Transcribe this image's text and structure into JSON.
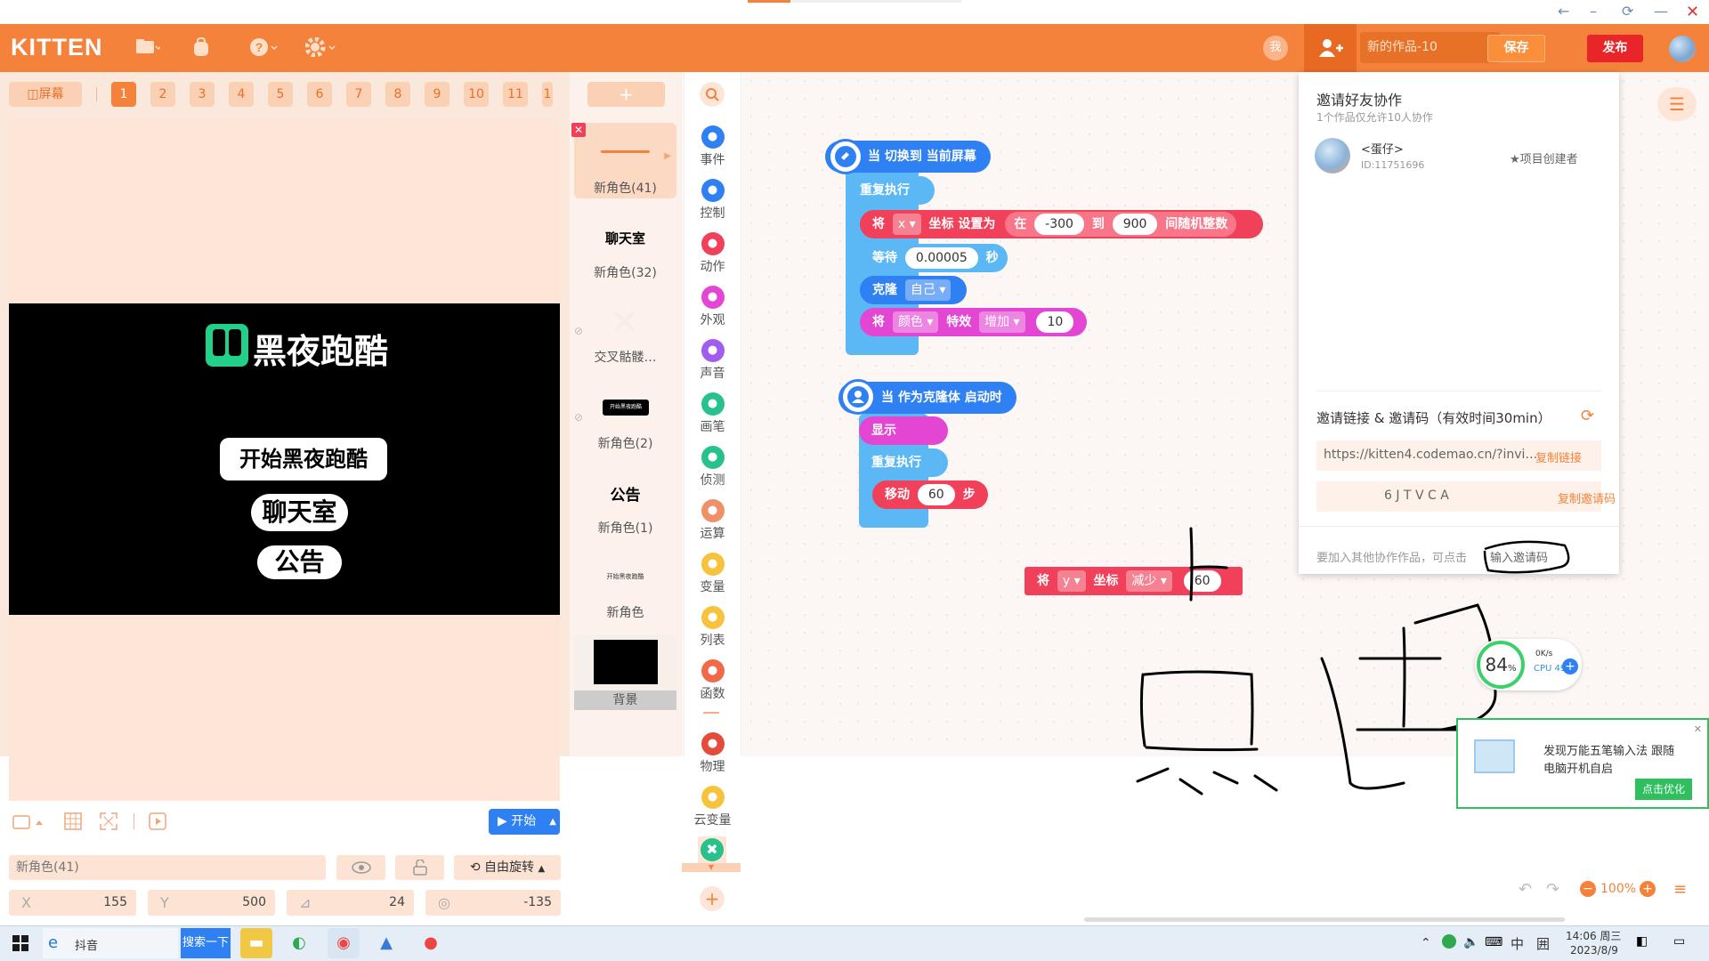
{
  "window": {
    "back": "←",
    "minimize": "–",
    "refresh": "⟳",
    "restore": "—",
    "close": "✕"
  },
  "topbar": {
    "logo": "KITTEN",
    "me": "我",
    "project_name": "新的作品-10",
    "save": "保存",
    "publish": "发布"
  },
  "stage": {
    "screen_button": "◫屏幕",
    "pages": [
      "1",
      "2",
      "3",
      "4",
      "5",
      "6",
      "7",
      "8",
      "9",
      "10",
      "11",
      "1"
    ],
    "brand": "黑夜跑酷",
    "buttons": [
      "开始黑夜跑酷",
      "聊天室",
      "公告"
    ],
    "start": "开始"
  },
  "properties": {
    "name": "新角色(41)",
    "rotate": "自由旋转",
    "x_label": "X",
    "x": "155",
    "y_label": "Y",
    "y": "500",
    "size": "24",
    "direction": "-135"
  },
  "sprites": {
    "add": "+",
    "items": [
      {
        "label": "新角色(41)",
        "thumb": ""
      },
      {
        "label": "新角色(32)",
        "thumb": "聊天室"
      },
      {
        "label": "交叉骷髅…",
        "thumb": ""
      },
      {
        "label": "新角色(2)",
        "thumb": "开始黑夜跑酷"
      },
      {
        "label": "新角色(1)",
        "thumb": "公告"
      },
      {
        "label": "新角色",
        "thumb": "开始黑夜跑酷"
      },
      {
        "label": "背景",
        "thumb": ""
      }
    ]
  },
  "categories": [
    {
      "label": "事件",
      "color": "#2e80f3"
    },
    {
      "label": "控制",
      "color": "#2e80f3"
    },
    {
      "label": "动作",
      "color": "#f0405a"
    },
    {
      "label": "外观",
      "color": "#e446d4"
    },
    {
      "label": "声音",
      "color": "#a05df0"
    },
    {
      "label": "画笔",
      "color": "#26c18d"
    },
    {
      "label": "侦测",
      "color": "#26c18d"
    },
    {
      "label": "运算",
      "color": "#f0906b"
    },
    {
      "label": "变量",
      "color": "#f7c23c"
    },
    {
      "label": "列表",
      "color": "#f7c23c"
    },
    {
      "label": "函数",
      "color": "#f06a4a"
    },
    {
      "label": "物理",
      "color": "#e44b3a"
    },
    {
      "label": "云变量",
      "color": "#f7c23c"
    }
  ],
  "blocks": {
    "hat1": "当 切换到 当前屏幕",
    "repeat1": "重复执行",
    "set_x_prefix": "将",
    "set_x_var": "x",
    "set_x_mid": "坐标 设置为",
    "set_x_in": "在",
    "set_x_min": "-300",
    "set_x_to": "到",
    "set_x_max": "900",
    "set_x_suffix": "间随机整数",
    "wait": "等待",
    "wait_val": "0.00005",
    "wait_unit": "秒",
    "clone": "克隆",
    "clone_target": "自己",
    "color_prefix": "将",
    "color_dd": "颜色",
    "color_mid": "特效",
    "color_op": "增加",
    "color_val": "10",
    "hat2": "当 作为克隆体 启动时",
    "show": "显示",
    "repeat2": "重复执行",
    "move": "移动",
    "move_val": "60",
    "move_unit": "步",
    "y_prefix": "将",
    "y_var": "y",
    "y_mid": "坐标",
    "y_op": "减少",
    "y_val": "60"
  },
  "invite": {
    "title": "邀请好友协作",
    "subtitle": "1个作品仅允许10人协作",
    "user_name": "<蛋仔>",
    "user_id": "ID:11751696",
    "role": "★项目创建者",
    "link_title": "邀请链接 & 邀请码（有效时间30min）",
    "link": "https://kitten4.codemao.cn/?invi…",
    "copy_link": "复制链接",
    "code": "6 J T V C A",
    "copy_code": "复制邀请码",
    "join_text": "要加入其他协作作品，可点击",
    "join_link": "输入邀请码"
  },
  "zoom": "100%",
  "net": {
    "pct": "84",
    "unit": "%",
    "speed": "0K/s",
    "cpu": "CPU 49℃"
  },
  "ad": {
    "line1": "发现万能五笔输入法 跟随",
    "line2": "电脑开机自启",
    "button": "点击优化",
    "close": "✕"
  },
  "taskbar": {
    "app": "抖音",
    "search": "搜索一下",
    "ime": "中",
    "time": "14:06 周三",
    "date": "2023/8/9"
  },
  "colors": {
    "accent": "#f5823b",
    "event": "#2e80f3",
    "motion": "#f0405a",
    "looks": "#e446d4",
    "control": "#5bb8f5"
  }
}
